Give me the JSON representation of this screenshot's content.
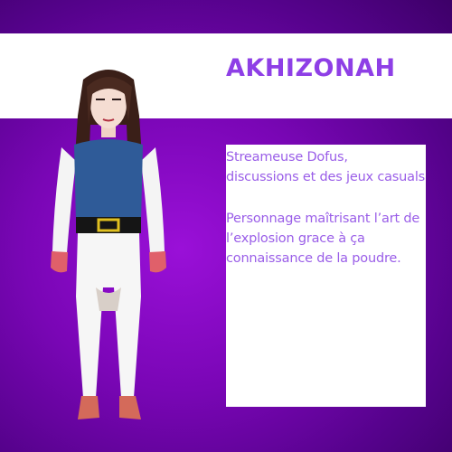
{
  "header": {
    "title": "AKHIZONAH"
  },
  "description": {
    "line1": "Streameuse Dofus,\ndiscussions et des jeux casuals",
    "line2": "Personnage maîtrisant l’art de\nl’explosion grace à ça\nconnaissance de la poudre."
  },
  "colors": {
    "background": "#7a06b6",
    "title": "#8e3fe6",
    "text": "#9a5ee8"
  }
}
